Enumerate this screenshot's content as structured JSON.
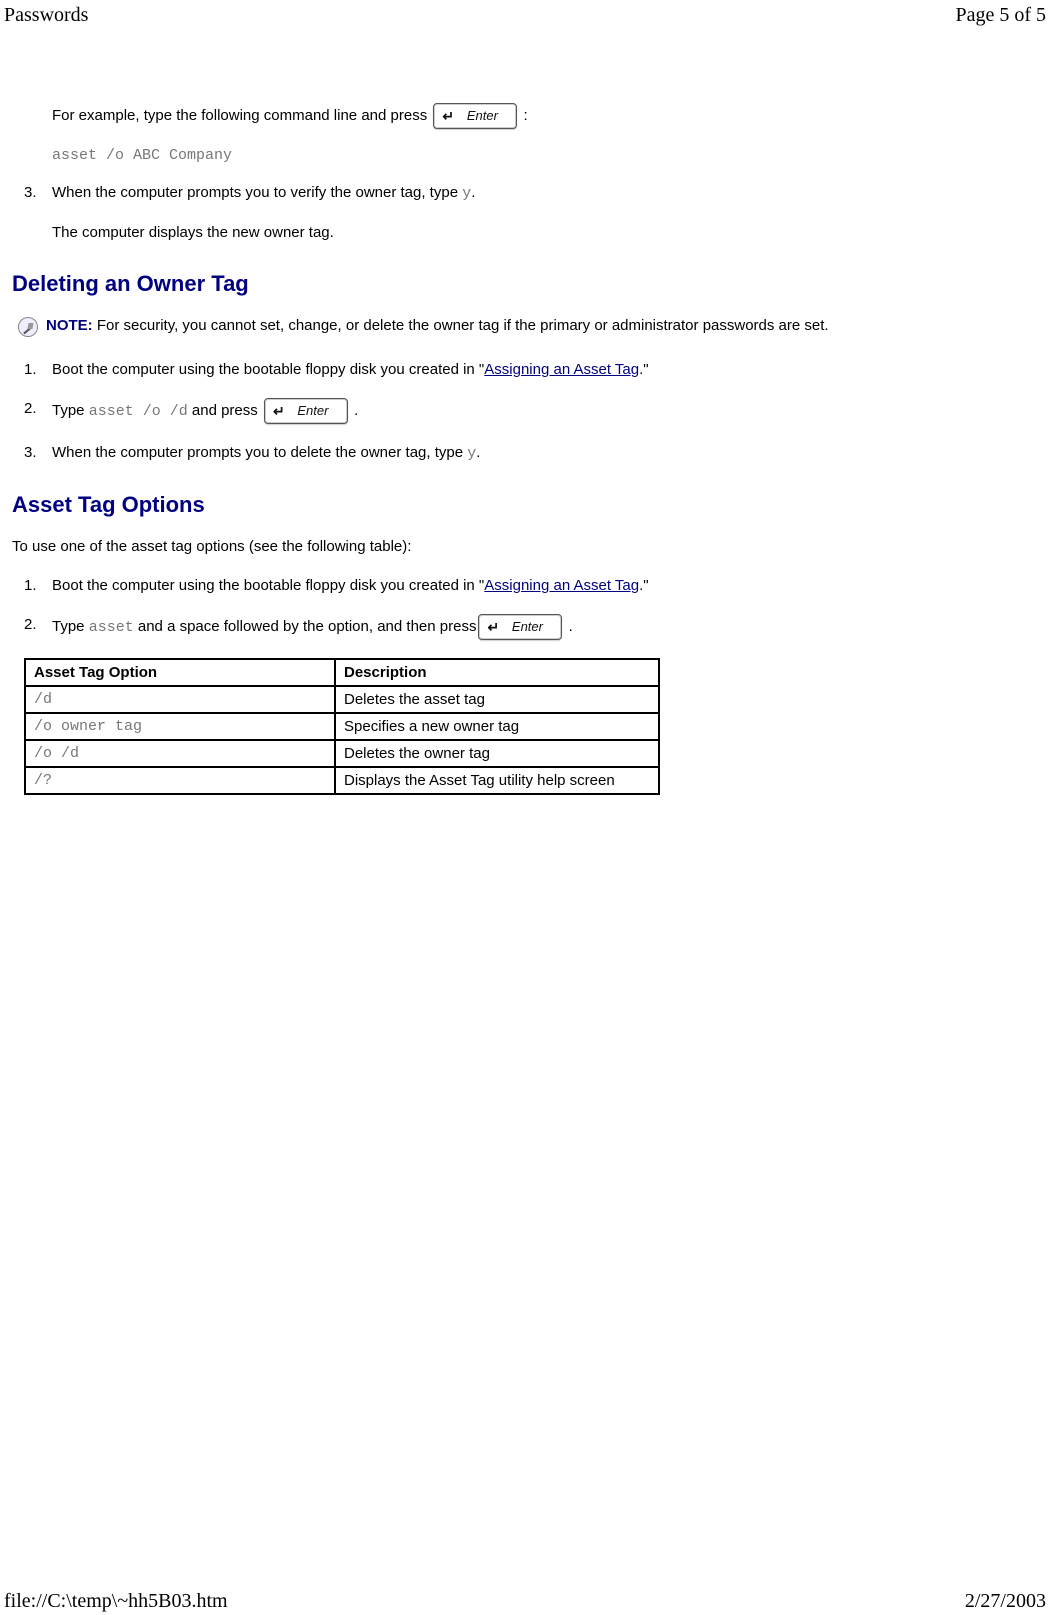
{
  "header": {
    "title_left": "Passwords",
    "title_right": "Page 5 of 5"
  },
  "footer": {
    "path": "file://C:\\temp\\~hh5B03.htm",
    "date": "2/27/2003"
  },
  "prior": {
    "example_intro_prefix": "For example, type the following command line and press",
    "example_intro_suffix": ":",
    "example_cmd": "asset /o ABC Company",
    "step3_num": "3.",
    "step3_prefix": "When the computer prompts you to verify the owner tag, type ",
    "step3_code": "y",
    "step3_suffix": ".",
    "step3_followup": "The computer displays the new owner tag."
  },
  "deleting": {
    "heading": "Deleting an Owner Tag",
    "note_label": "NOTE: ",
    "note_text": "For security, you cannot set, change, or delete the owner tag if the primary or administrator passwords are set.",
    "step1_num": "1.",
    "step1_prefix": "Boot the computer using the bootable floppy disk you created in \"",
    "step1_link": "Assigning an Asset Tag",
    "step1_suffix": ".\"",
    "step2_num": "2.",
    "step2_prefix": "Type ",
    "step2_code": "asset /o /d",
    "step2_mid": " and press ",
    "step2_suffix": " .",
    "step3_num": "3.",
    "step3_prefix": "When the computer prompts you to delete the owner tag, type ",
    "step3_code": "y",
    "step3_suffix": "."
  },
  "options": {
    "heading": "Asset Tag Options",
    "intro": "To use one of the asset tag options (see the following table):",
    "step1_num": "1.",
    "step1_prefix": "Boot the computer using the bootable floppy disk you created in \"",
    "step1_link": "Assigning an Asset Tag",
    "step1_suffix": ".\"",
    "step2_num": "2.",
    "step2_prefix": "Type ",
    "step2_code": "asset",
    "step2_mid": " and a space followed by the option, and then press",
    "step2_suffix": " .",
    "table": {
      "h_option": "Asset Tag Option",
      "h_desc": "Description",
      "rows": [
        {
          "opt": "/d",
          "desc": "Deletes the asset tag"
        },
        {
          "opt": "/o owner tag",
          "desc": "Specifies a new owner tag"
        },
        {
          "opt": "/o /d",
          "desc": "Deletes the owner tag"
        },
        {
          "opt": "/?",
          "desc": "Displays the Asset Tag utility help screen"
        }
      ]
    }
  },
  "key_label": "Enter"
}
